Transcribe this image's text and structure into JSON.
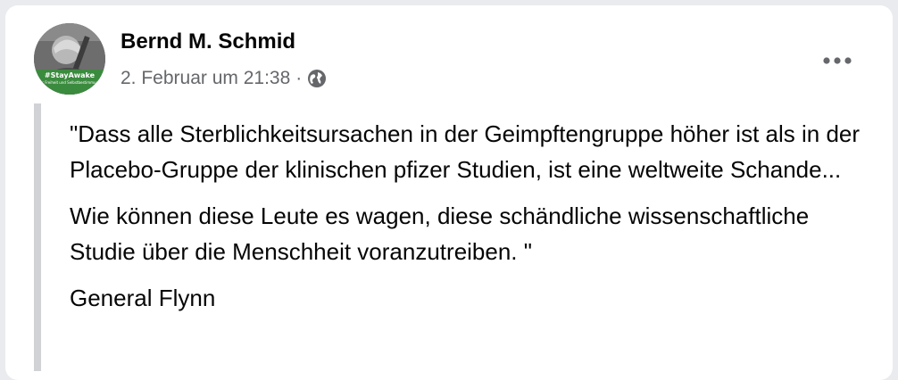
{
  "post": {
    "author": "Bernd M. Schmid",
    "timestamp": "2. Februar um 21:38",
    "separator": "·",
    "privacy_icon": "globe-icon",
    "more_icon": "more-options-icon",
    "avatar": {
      "badge_tag": "#StayAwake",
      "badge_sub": "für Freiheit und Selbstbestimmung",
      "badge_color": "#3b8b3e"
    },
    "paragraphs": [
      "\"Dass alle Sterblichkeitsursachen in der Geimpftengruppe höher ist als in der Placebo-Gruppe der klinischen pfizer Studien, ist eine weltweite Schande...",
      "Wie können diese Leute es wagen, diese schändliche wissenschaftliche Studie über die Menschheit voranzutreiben. \"",
      "General Flynn"
    ]
  },
  "colors": {
    "background": "#e9ebee",
    "card": "#ffffff",
    "text": "#050505",
    "secondary_text": "#65676b",
    "quote_bar": "#d0d2d6"
  }
}
